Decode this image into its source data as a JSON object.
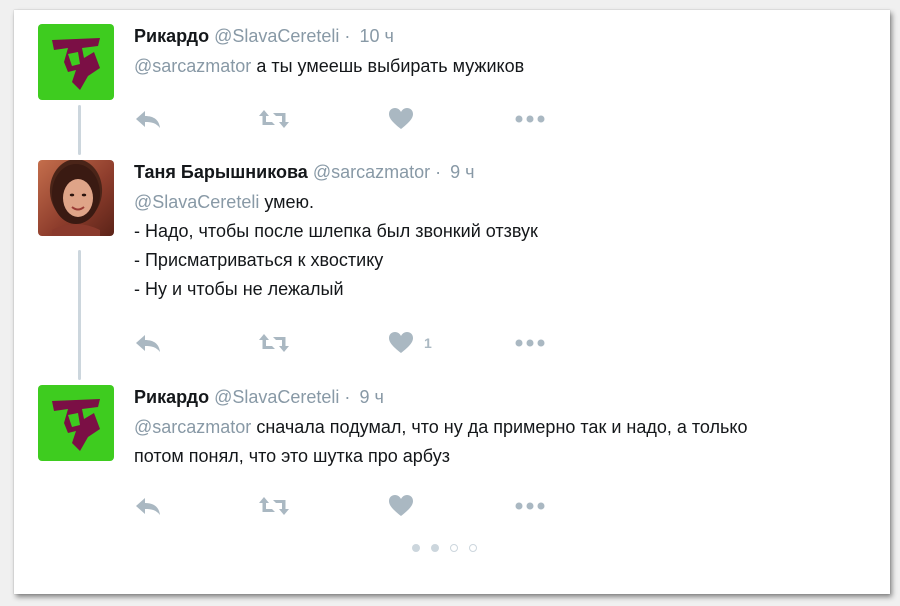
{
  "tweets": [
    {
      "name": "Рикардо",
      "handle": "@SlavaCereteli",
      "dot": "·",
      "time": "10 ч",
      "mention": "@sarcazmator",
      "lines": [
        "а ты умеешь выбирать мужиков"
      ],
      "likes": ""
    },
    {
      "name": "Таня Барышникова",
      "handle": "@sarcazmator",
      "dot": "·",
      "time": "9 ч",
      "mention": "@SlavaCereteli",
      "lines": [
        "умею.",
        "- Надо, чтобы после шлепка был звонкий отзвук",
        "- Присматриваться к хвостику",
        "- Ну и чтобы не лежалый"
      ],
      "likes": "1"
    },
    {
      "name": "Рикардо",
      "handle": "@SlavaCereteli",
      "dot": "·",
      "time": "9 ч",
      "mention": "@sarcazmator",
      "lines": [
        "сначала подумал, что ну да примерно так и надо, а только",
        "потом понял, что это шутка про арбуз"
      ],
      "likes": ""
    }
  ],
  "icons": {
    "reply": "reply-icon",
    "retweet": "retweet-icon",
    "like": "heart-icon",
    "more": "more-icon",
    "avatar_logo": "letter-logo-avatar",
    "avatar_photo": "user-photo-avatar"
  },
  "pagination": {
    "total": 4,
    "active": [
      0,
      1
    ]
  },
  "colors": {
    "muted": "#8899a6",
    "icon": "#aab8c2",
    "logo_bg": "#3ecc1f",
    "logo_glyph": "#7b0f45"
  }
}
